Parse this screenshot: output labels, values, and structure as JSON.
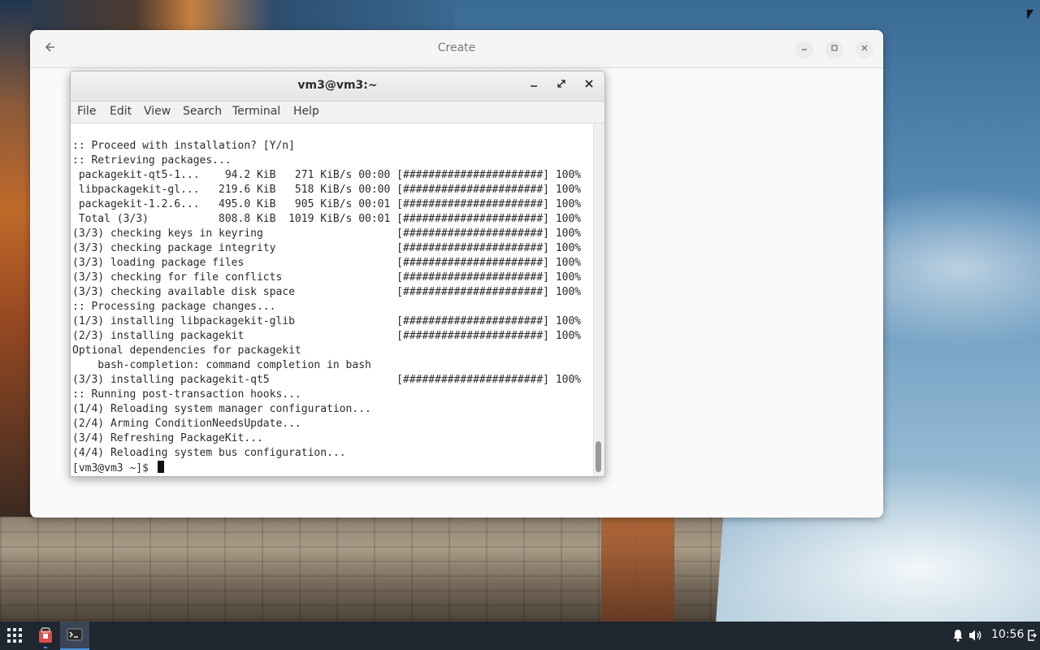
{
  "create_window": {
    "title": "Create",
    "back_icon": "arrow-left-icon",
    "minimize_icon": "minimize-icon",
    "maximize_icon": "maximize-icon",
    "close_icon": "close-icon"
  },
  "terminal": {
    "title": "vm3@vm3:~",
    "menu": [
      "File",
      "Edit",
      "View",
      "Search",
      "Terminal",
      "Help"
    ],
    "lines": [
      ":: Proceed with installation? [Y/n]",
      ":: Retrieving packages...",
      " packagekit-qt5-1...    94.2 KiB   271 KiB/s 00:00 [######################] 100%",
      " libpackagekit-gl...   219.6 KiB   518 KiB/s 00:00 [######################] 100%",
      " packagekit-1.2.6...   495.0 KiB   905 KiB/s 00:01 [######################] 100%",
      " Total (3/3)           808.8 KiB  1019 KiB/s 00:01 [######################] 100%",
      "(3/3) checking keys in keyring                     [######################] 100%",
      "(3/3) checking package integrity                   [######################] 100%",
      "(3/3) loading package files                        [######################] 100%",
      "(3/3) checking for file conflicts                  [######################] 100%",
      "(3/3) checking available disk space                [######################] 100%",
      ":: Processing package changes...",
      "(1/3) installing libpackagekit-glib                [######################] 100%",
      "(2/3) installing packagekit                        [######################] 100%",
      "Optional dependencies for packagekit",
      "    bash-completion: command completion in bash",
      "(3/3) installing packagekit-qt5                    [######################] 100%",
      ":: Running post-transaction hooks...",
      "(1/4) Reloading system manager configuration...",
      "(2/4) Arming ConditionNeedsUpdate...",
      "(3/4) Refreshing PackageKit...",
      "(4/4) Reloading system bus configuration..."
    ],
    "prompt": "[vm3@vm3 ~]$ "
  },
  "taskbar": {
    "apps": [
      {
        "icon": "app-grid-icon",
        "active": false
      },
      {
        "icon": "software-store-icon",
        "active": false
      },
      {
        "icon": "terminal-icon",
        "active": true
      }
    ],
    "tray": {
      "notification_icon": "bell-icon",
      "volume_icon": "speaker-icon",
      "clock": "10:56",
      "logout_icon": "exit-icon"
    }
  }
}
